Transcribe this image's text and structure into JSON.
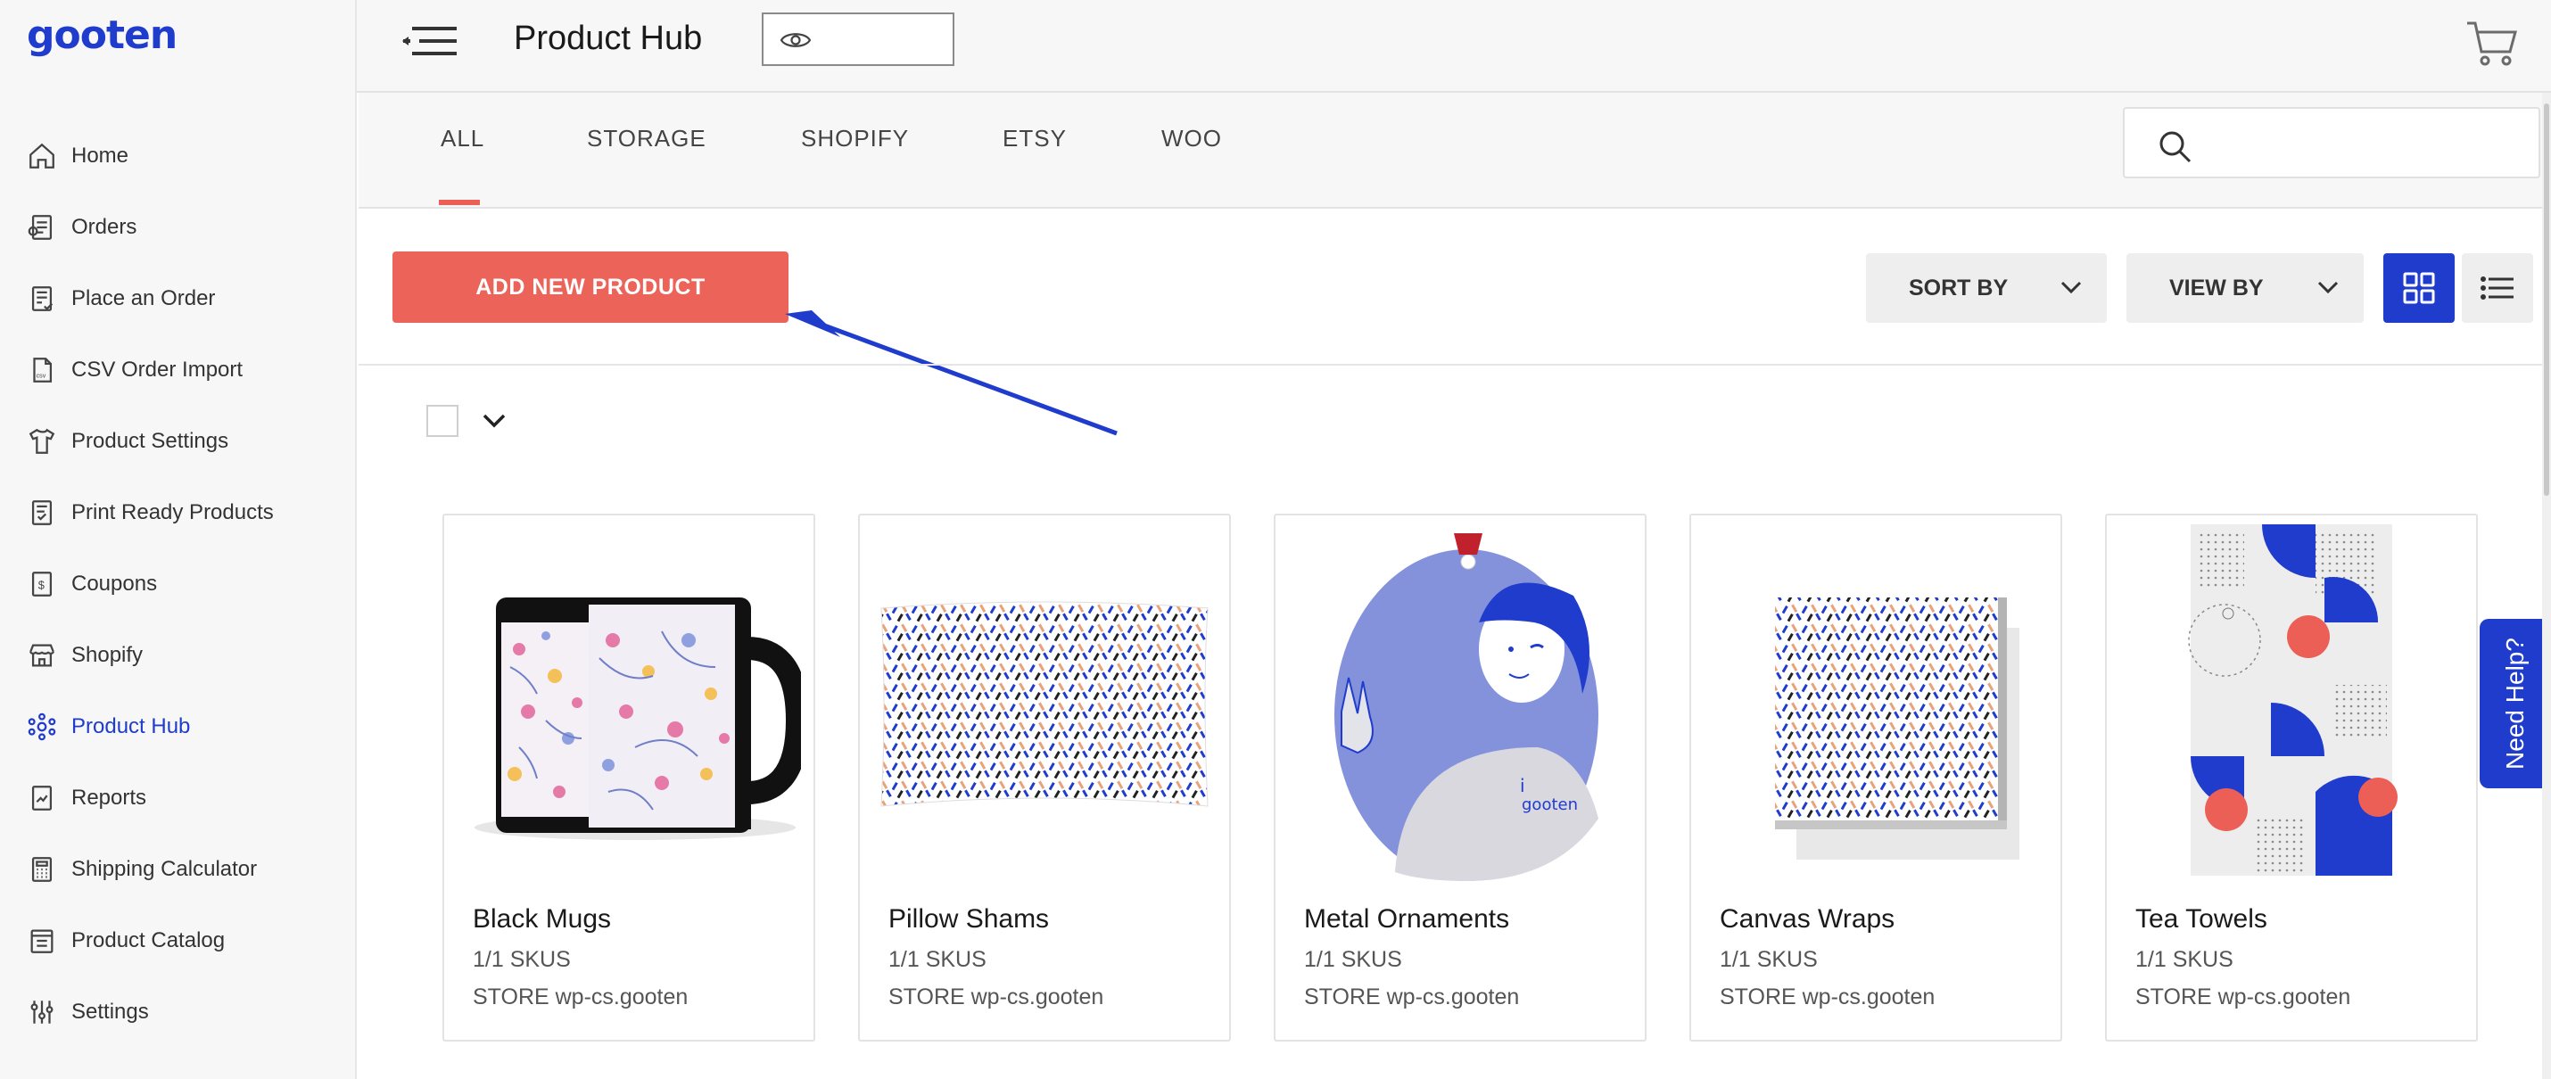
{
  "brand": {
    "logo": "gooten",
    "accent": "#1f3ccc",
    "cta": "#ec6359"
  },
  "sidebar": {
    "items": [
      {
        "label": "Home",
        "icon": "home-icon",
        "active": false
      },
      {
        "label": "Orders",
        "icon": "orders-icon",
        "active": false
      },
      {
        "label": "Place an Order",
        "icon": "place-order-icon",
        "active": false
      },
      {
        "label": "CSV Order Import",
        "icon": "csv-icon",
        "active": false
      },
      {
        "label": "Product Settings",
        "icon": "tshirt-icon",
        "active": false
      },
      {
        "label": "Print Ready Products",
        "icon": "print-ready-icon",
        "active": false
      },
      {
        "label": "Coupons",
        "icon": "coupon-icon",
        "active": false
      },
      {
        "label": "Shopify",
        "icon": "shopify-icon",
        "active": false
      },
      {
        "label": "Product Hub",
        "icon": "product-hub-icon",
        "active": true
      },
      {
        "label": "Reports",
        "icon": "reports-icon",
        "active": false
      },
      {
        "label": "Shipping Calculator",
        "icon": "calculator-icon",
        "active": false
      },
      {
        "label": "Product Catalog",
        "icon": "catalog-icon",
        "active": false
      },
      {
        "label": "Settings",
        "icon": "sliders-icon",
        "active": false
      }
    ]
  },
  "header": {
    "title": "Product Hub"
  },
  "tabs": [
    {
      "label": "ALL",
      "active": true
    },
    {
      "label": "STORAGE",
      "active": false
    },
    {
      "label": "SHOPIFY",
      "active": false
    },
    {
      "label": "ETSY",
      "active": false
    },
    {
      "label": "WOO",
      "active": false
    }
  ],
  "search": {
    "placeholder": ""
  },
  "actions": {
    "add_label": "ADD NEW PRODUCT",
    "sort_label": "SORT BY",
    "view_label": "VIEW BY"
  },
  "products": [
    {
      "title": "Black Mugs",
      "skus": "1/1 SKUS",
      "store": "STORE wp-cs.gooten",
      "image": "mug"
    },
    {
      "title": "Pillow Shams",
      "skus": "1/1 SKUS",
      "store": "STORE wp-cs.gooten",
      "image": "pillow"
    },
    {
      "title": "Metal Ornaments",
      "skus": "1/1 SKUS",
      "store": "STORE wp-cs.gooten",
      "image": "ornament"
    },
    {
      "title": "Canvas Wraps",
      "skus": "1/1 SKUS",
      "store": "STORE wp-cs.gooten",
      "image": "canvas"
    },
    {
      "title": "Tea Towels",
      "skus": "1/1 SKUS",
      "store": "STORE wp-cs.gooten",
      "image": "towel"
    }
  ],
  "help": {
    "label": "Need Help?"
  }
}
